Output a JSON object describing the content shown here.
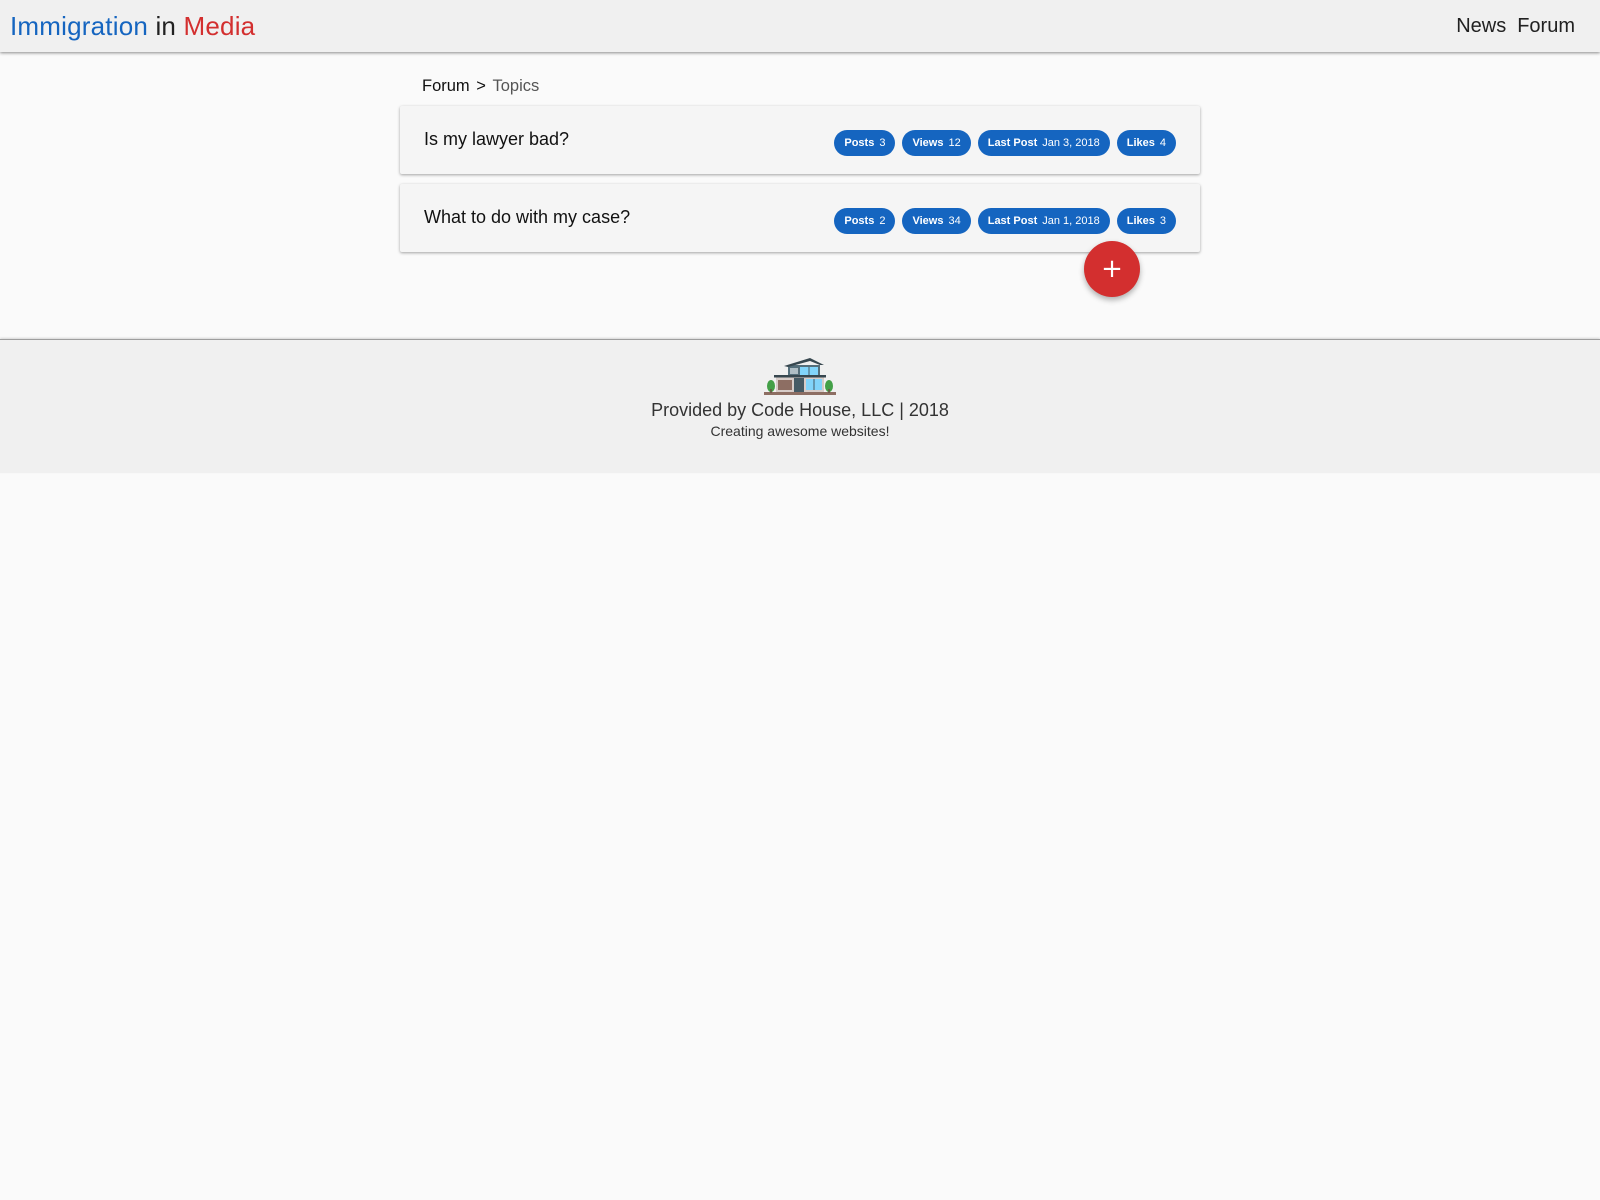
{
  "header": {
    "brand": {
      "part1": "Immigration",
      "part2": "in",
      "part3": "Media"
    },
    "nav": [
      "News",
      "Forum"
    ]
  },
  "breadcrumb": {
    "root": "Forum",
    "separator": ">",
    "current": "Topics"
  },
  "topics": [
    {
      "title": "Is my lawyer bad?",
      "stats": [
        {
          "label": "Posts",
          "value": "3"
        },
        {
          "label": "Views",
          "value": "12"
        },
        {
          "label": "Last Post",
          "value": "Jan 3, 2018"
        },
        {
          "label": "Likes",
          "value": "4"
        }
      ]
    },
    {
      "title": "What to do with my case?",
      "stats": [
        {
          "label": "Posts",
          "value": "2"
        },
        {
          "label": "Views",
          "value": "34"
        },
        {
          "label": "Last Post",
          "value": "Jan 1, 2018"
        },
        {
          "label": "Likes",
          "value": "3"
        }
      ]
    }
  ],
  "fab": {
    "icon": "plus-icon",
    "glyph": "+"
  },
  "footer": {
    "logo": "house-logo",
    "line1": "Provided by Code House, LLC | 2018",
    "line2": "Creating awesome websites!"
  },
  "colors": {
    "brand_blue": "#1565c0",
    "brand_red": "#d32f2f",
    "chip_bg": "#1565c0",
    "fab_bg": "#d32f2f"
  }
}
